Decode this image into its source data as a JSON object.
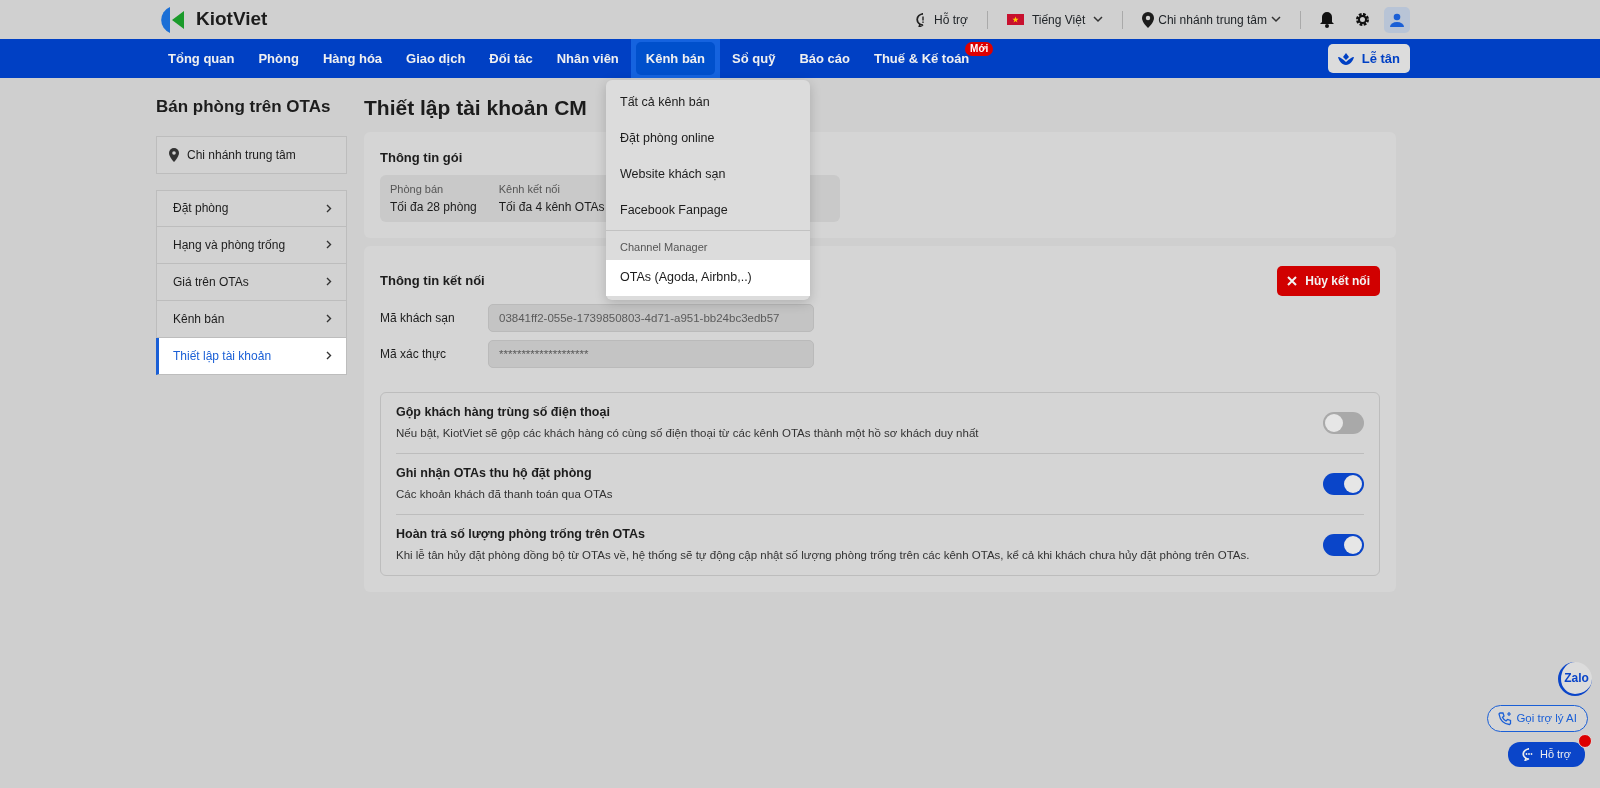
{
  "header": {
    "logo_text": "KiotViet",
    "help": "Hỗ trợ",
    "language": "Tiếng Việt",
    "branch": "Chi nhánh trung tâm"
  },
  "nav": {
    "items": [
      {
        "label": "Tổng quan",
        "selected": false
      },
      {
        "label": "Phòng",
        "selected": false
      },
      {
        "label": "Hàng hóa",
        "selected": false
      },
      {
        "label": "Giao dịch",
        "selected": false
      },
      {
        "label": "Đối tác",
        "selected": false
      },
      {
        "label": "Nhân viên",
        "selected": false
      },
      {
        "label": "Kênh bán",
        "selected": true
      },
      {
        "label": "Sổ quỹ",
        "selected": false
      },
      {
        "label": "Báo cáo",
        "selected": false
      },
      {
        "label": "Thuế & Kế toán",
        "selected": false,
        "badge": "Mới"
      }
    ],
    "reception_button": "Lễ tân"
  },
  "dropdown": {
    "items": [
      {
        "kind": "item",
        "label": "Tất cả kênh bán",
        "selected": false
      },
      {
        "kind": "item",
        "label": "Đặt phòng online",
        "selected": false
      },
      {
        "kind": "item",
        "label": "Website khách sạn",
        "selected": false
      },
      {
        "kind": "item",
        "label": "Facebook Fanpage",
        "selected": false
      },
      {
        "kind": "header",
        "label": "Channel Manager"
      },
      {
        "kind": "item",
        "label": "OTAs (Agoda, Airbnb,..)",
        "selected": true
      }
    ]
  },
  "sidebar": {
    "title": "Bán phòng trên OTAs",
    "branch": "Chi nhánh trung tâm",
    "items": [
      {
        "label": "Đặt phòng",
        "selected": false
      },
      {
        "label": "Hạng và phòng trống",
        "selected": false
      },
      {
        "label": "Giá trên OTAs",
        "selected": false
      },
      {
        "label": "Kênh bán",
        "selected": false
      },
      {
        "label": "Thiết lập tài khoản",
        "selected": true
      }
    ]
  },
  "main": {
    "title": "Thiết lập tài khoản CM",
    "package": {
      "title": "Thông tin gói",
      "fields": [
        {
          "label": "Phòng bán",
          "value": "Tối đa 28 phòng"
        },
        {
          "label": "Kênh kết nối",
          "value": "Tối đa 4 kênh OTAs"
        }
      ]
    },
    "connection": {
      "title": "Thông tin kết nối",
      "cancel_button": "Hủy kết nối",
      "fields": [
        {
          "label": "Mã khách sạn",
          "value": "03841ff2-055e-1739850803-4d71-a951-bb24bc3edb57"
        },
        {
          "label": "Mã xác thực",
          "value": "********************"
        }
      ],
      "settings": [
        {
          "title": "Gộp khách hàng trùng số điện thoại",
          "description": "Nếu bật, KiotViet sẽ gộp các khách hàng có cùng số điện thoại từ các kênh OTAs thành một hồ sơ khách duy nhất",
          "on": false
        },
        {
          "title": "Ghi nhận OTAs thu hộ đặt phòng",
          "description": "Các khoản khách đã thanh toán qua OTAs",
          "on": true
        },
        {
          "title": "Hoàn trả số lượng phòng trống trên OTAs",
          "description": "Khi lễ tân hủy đặt phòng đồng bộ từ OTAs về, hệ thống sẽ tự động cập nhật số lượng phòng trống trên các kênh OTAs, kể cả khi khách chưa hủy đặt phòng trên OTAs.",
          "on": true
        }
      ]
    }
  },
  "widgets": {
    "zalo": "Zalo",
    "ai_button": "Gọi trợ lý AI",
    "help_button": "Hỗ trợ"
  }
}
